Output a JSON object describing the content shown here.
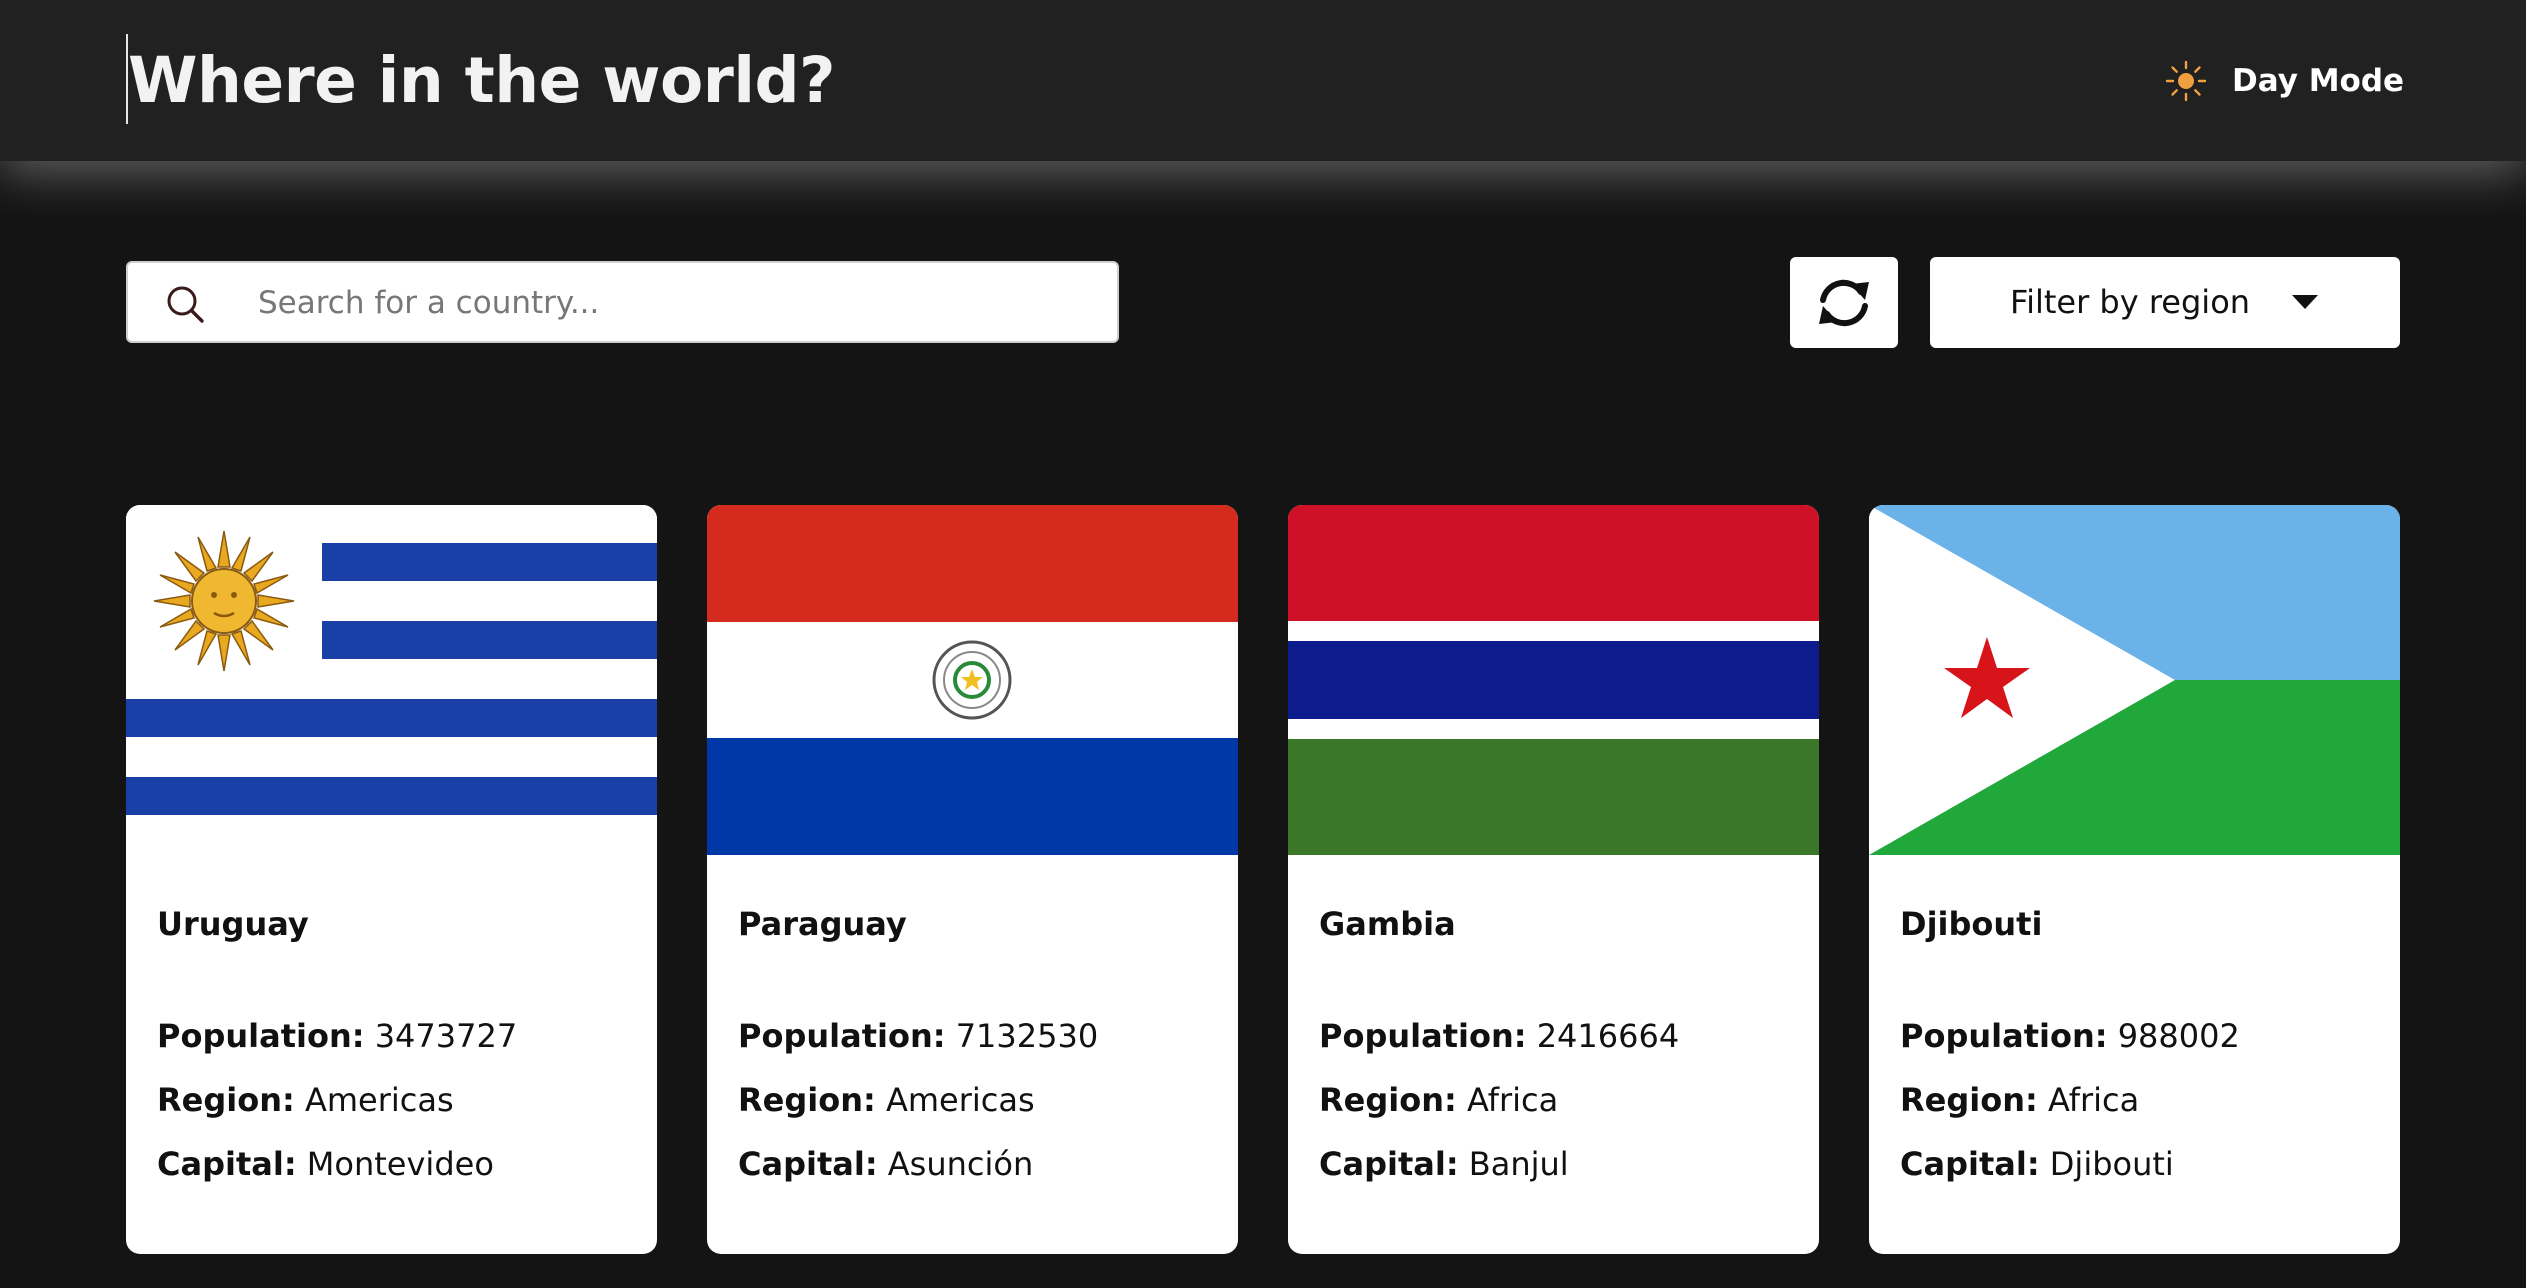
{
  "header": {
    "title": "Where in the world?",
    "mode_label": "Day Mode",
    "mode_icon": "sun-icon"
  },
  "search": {
    "placeholder": "Search for a country...",
    "icon": "search-icon"
  },
  "controls": {
    "refresh_icon": "refresh-icon",
    "filter_label": "Filter by region",
    "filter_icon": "caret-down-icon"
  },
  "labels": {
    "population": "Population:",
    "region": "Region:",
    "capital": "Capital:"
  },
  "countries": [
    {
      "name": "Uruguay",
      "population": "3473727",
      "region": "Americas",
      "capital": "Montevideo"
    },
    {
      "name": "Paraguay",
      "population": "7132530",
      "region": "Americas",
      "capital": "Asunción"
    },
    {
      "name": "Gambia",
      "population": "2416664",
      "region": "Africa",
      "capital": "Banjul"
    },
    {
      "name": "Djibouti",
      "population": "988002",
      "region": "Africa",
      "capital": "Djibouti"
    }
  ],
  "colors": {
    "background": "#141414",
    "header": "#212121",
    "card": "#ffffff",
    "sun": "#f0a040"
  }
}
